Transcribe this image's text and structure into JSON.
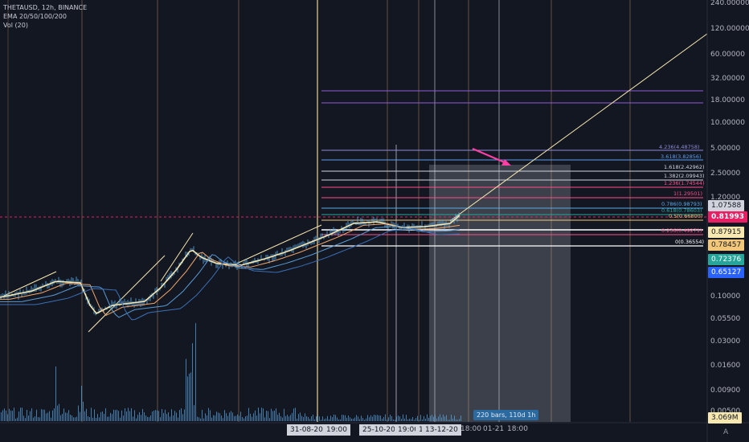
{
  "legend": {
    "symbol": "THETAUSD, 12h, BINANCE",
    "ema": "EMA 20/50/100/200",
    "vol": "Vol (20)"
  },
  "price_scale": [
    "240.00000",
    "120.00000",
    "60.00000",
    "32.00000",
    "18.00000",
    "10.00000",
    "5.00000",
    "2.50000",
    "1.20000",
    "0.10000",
    "0.05500",
    "0.03000",
    "0.01600",
    "0.00900",
    "0.00500"
  ],
  "price_boxes": [
    {
      "label": "1.07588",
      "bg": "#d1d4dc",
      "fg": "#131722"
    },
    {
      "label": "0.81993",
      "bg": "#e91e63",
      "fg": "#ffffff"
    },
    {
      "label": "0.87915",
      "bg": "#f7e8b0",
      "fg": "#131722"
    },
    {
      "label": "0.78457",
      "bg": "#f2c77a",
      "fg": "#131722"
    },
    {
      "label": "0.72376",
      "bg": "#26a69a",
      "fg": "#ffffff"
    },
    {
      "label": "0.65127",
      "bg": "#2962ff",
      "fg": "#ffffff"
    },
    {
      "label": "3.069M",
      "bg": "#f7e8b0",
      "fg": "#131722"
    }
  ],
  "fib_labels": [
    {
      "text": "4.236(4.48758)",
      "color": "#8e8cd8"
    },
    {
      "text": "3.618(3.82856)",
      "color": "#5d9cec"
    },
    {
      "text": "1.618(2.42962)",
      "color": "#d1d4dc"
    },
    {
      "text": "1.382(2.09943)",
      "color": "#d1d4dc"
    },
    {
      "text": "1.236(1.74544)",
      "color": "#ff4d8a"
    },
    {
      "text": "1(1.29501)",
      "color": "#ff4d8a"
    },
    {
      "text": "0.786(0.98793)",
      "color": "#5aa9e6"
    },
    {
      "text": "0.618(0.78603)",
      "color": "#26a69a"
    },
    {
      "text": "0.5(0.66800)",
      "color": "#f2c77a"
    },
    {
      "text": "0.236(0.49271)",
      "color": "#ff4d8a"
    },
    {
      "text": "0(0.36554)",
      "color": "#ffffff"
    }
  ],
  "time_labels": [
    {
      "text": "31-08-20",
      "highlight": true
    },
    {
      "text": "19:00",
      "highlight": true
    },
    {
      "text": "25-10-20",
      "highlight": true
    },
    {
      "text": "19:00",
      "highlight": true
    },
    {
      "text": "1",
      "highlight": true
    },
    {
      "text": "13-12-20",
      "highlight": true
    },
    {
      "text": "18:00",
      "highlight": false
    },
    {
      "text": "01-21",
      "highlight": false
    },
    {
      "text": "18:00",
      "highlight": false
    }
  ],
  "range_info": "220 bars, 110d 1h",
  "auto_button": "A",
  "colors": {
    "background": "#131722",
    "candle": "#5aa9e6",
    "ema20": "#f7e8b0",
    "ema50": "#f2a86b",
    "ema100": "#5b9bd5",
    "ema200": "#3b6fb6",
    "arrow": "#ff3fa4",
    "trend": "#f7e8b0"
  }
}
